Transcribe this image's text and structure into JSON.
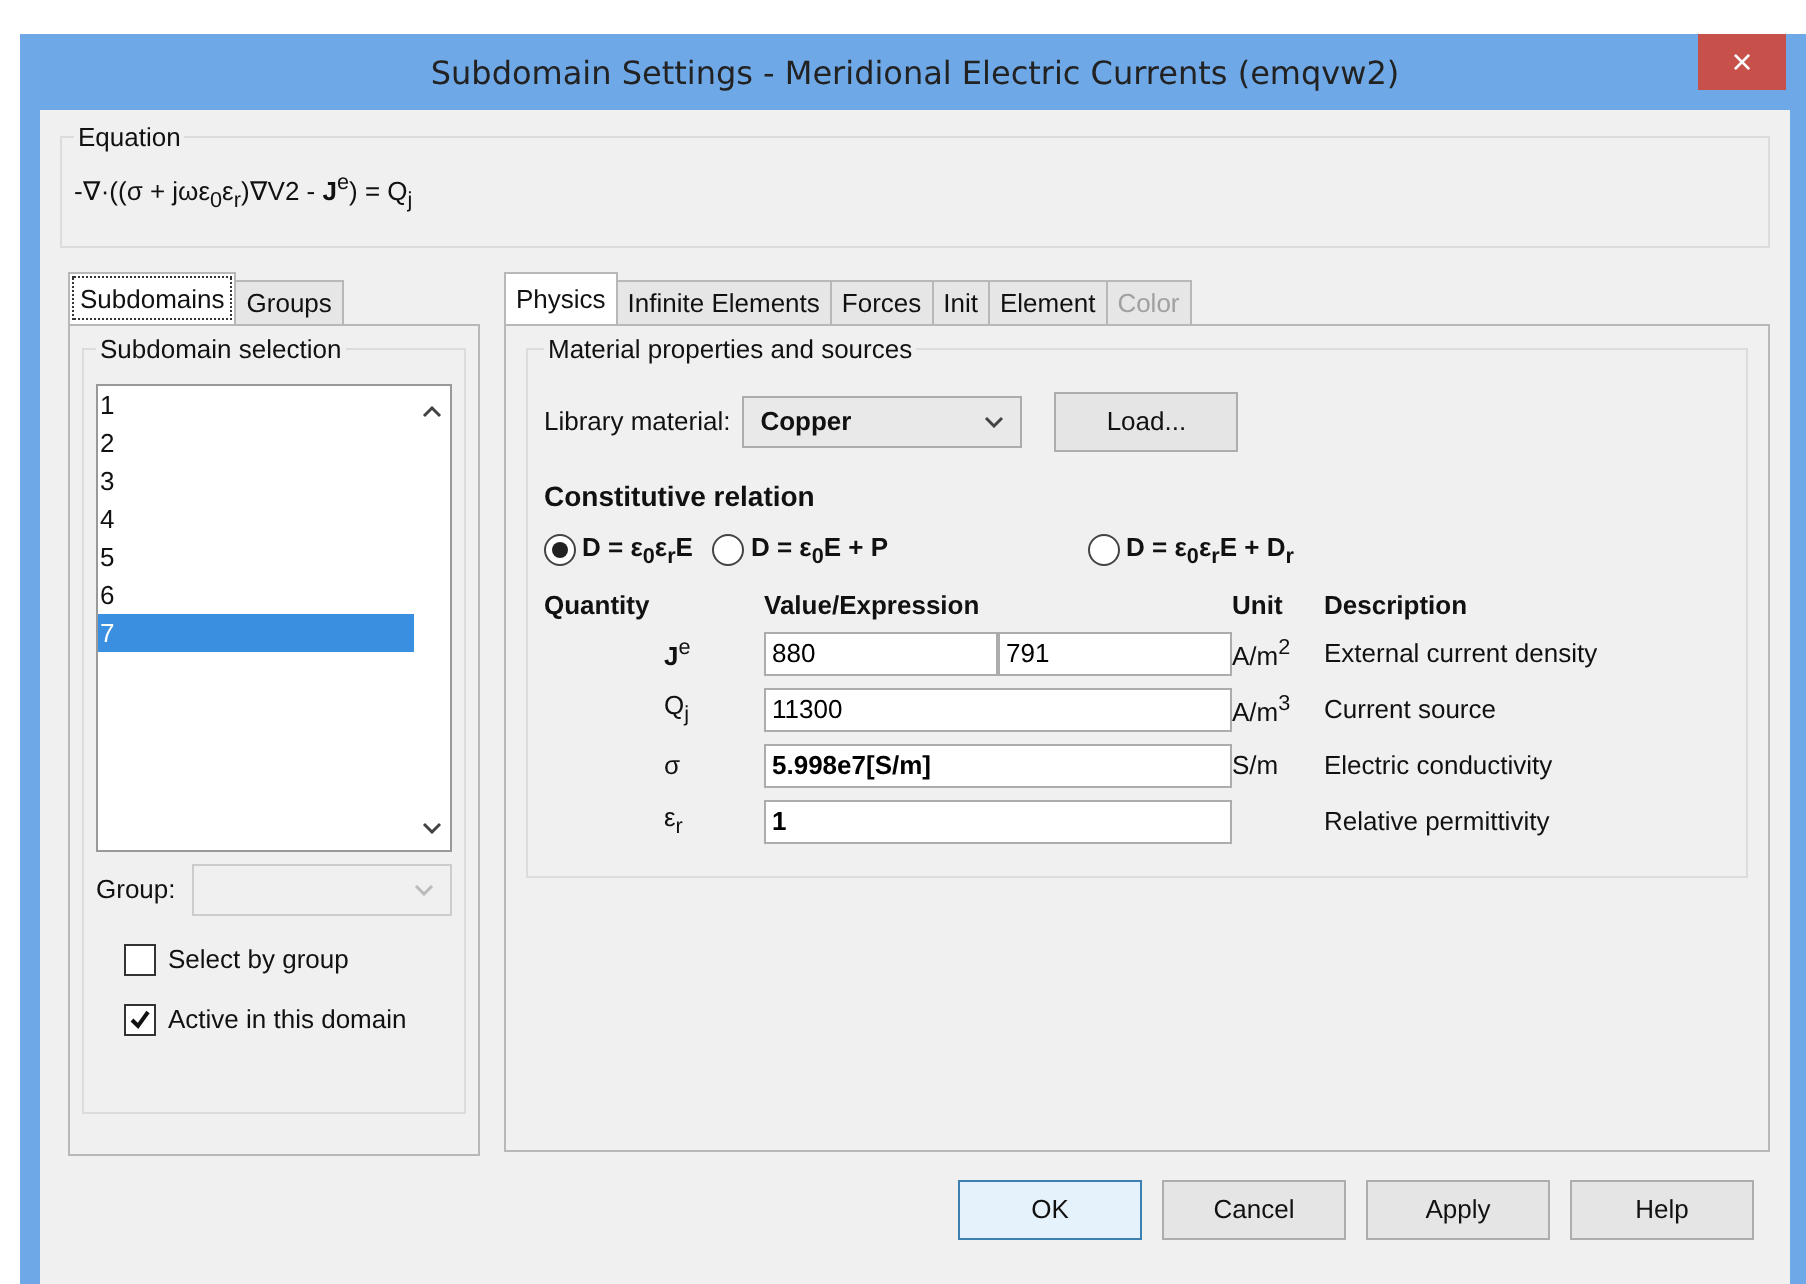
{
  "window": {
    "title": "Subdomain Settings - Meridional Electric Currents (emqvw2)",
    "close": "×"
  },
  "equation": {
    "label": "Equation",
    "text": "-∇·((σ + jωε$_{0}$ε$_{r}$)∇V2 - **J**$^{e}$) = Q$_{j}$"
  },
  "left_tabs": [
    {
      "label": "Subdomains",
      "selected": true
    },
    {
      "label": "Groups",
      "selected": false
    }
  ],
  "subdomain_selection": {
    "label": "Subdomain selection",
    "items": [
      {
        "label": "1",
        "selected": false
      },
      {
        "label": "2",
        "selected": false
      },
      {
        "label": "3",
        "selected": false
      },
      {
        "label": "4",
        "selected": false
      },
      {
        "label": "5",
        "selected": false
      },
      {
        "label": "6",
        "selected": false
      },
      {
        "label": "7",
        "selected": true
      }
    ],
    "group_label": "Group:",
    "group_disabled": true,
    "checkboxes": [
      {
        "label": "Select by group",
        "checked": false
      },
      {
        "label": "Active in this domain",
        "checked": true
      }
    ]
  },
  "tabs": [
    {
      "label": "Physics",
      "selected": true,
      "disabled": false
    },
    {
      "label": "Infinite Elements",
      "selected": false,
      "disabled": false
    },
    {
      "label": "Forces",
      "selected": false,
      "disabled": false
    },
    {
      "label": "Init",
      "selected": false,
      "disabled": false
    },
    {
      "label": "Element",
      "selected": false,
      "disabled": false
    },
    {
      "label": "Color",
      "selected": false,
      "disabled": true
    }
  ],
  "material": {
    "group_label": "Material properties and sources",
    "library_label": "Library material:",
    "library_value": "Copper",
    "load_button": "Load...",
    "relation_heading": "Constitutive relation",
    "relations": [
      {
        "label": "D = ε$_{0}$ε$_{r}$E",
        "selected": true
      },
      {
        "label": "D = ε$_{0}$E + P",
        "selected": false
      },
      {
        "label": "D = ε$_{0}$ε$_{r}$E + D$_{r}$",
        "selected": false
      }
    ],
    "columns": [
      "Quantity",
      "Value/Expression",
      "Unit",
      "Description"
    ],
    "rows": [
      {
        "quantity": "**J**$^{e}$",
        "values": [
          "880",
          "791"
        ],
        "bold": false,
        "unit": "A/m$^{2}$",
        "description": "External current density"
      },
      {
        "quantity": "Q$_{j}$",
        "values": [
          "11300"
        ],
        "bold": false,
        "unit": "A/m$^{3}$",
        "description": "Current source"
      },
      {
        "quantity": "σ",
        "values": [
          "5.998e7[S/m]"
        ],
        "bold": true,
        "unit": "S/m",
        "description": "Electric conductivity"
      },
      {
        "quantity": "ε$_{r}$",
        "values": [
          "1"
        ],
        "bold": true,
        "description": "Relative permittivity"
      }
    ]
  },
  "buttons": [
    {
      "label": "OK",
      "default": true
    },
    {
      "label": "Cancel",
      "default": false
    },
    {
      "label": "Apply",
      "default": false
    },
    {
      "label": "Help",
      "default": false
    }
  ]
}
